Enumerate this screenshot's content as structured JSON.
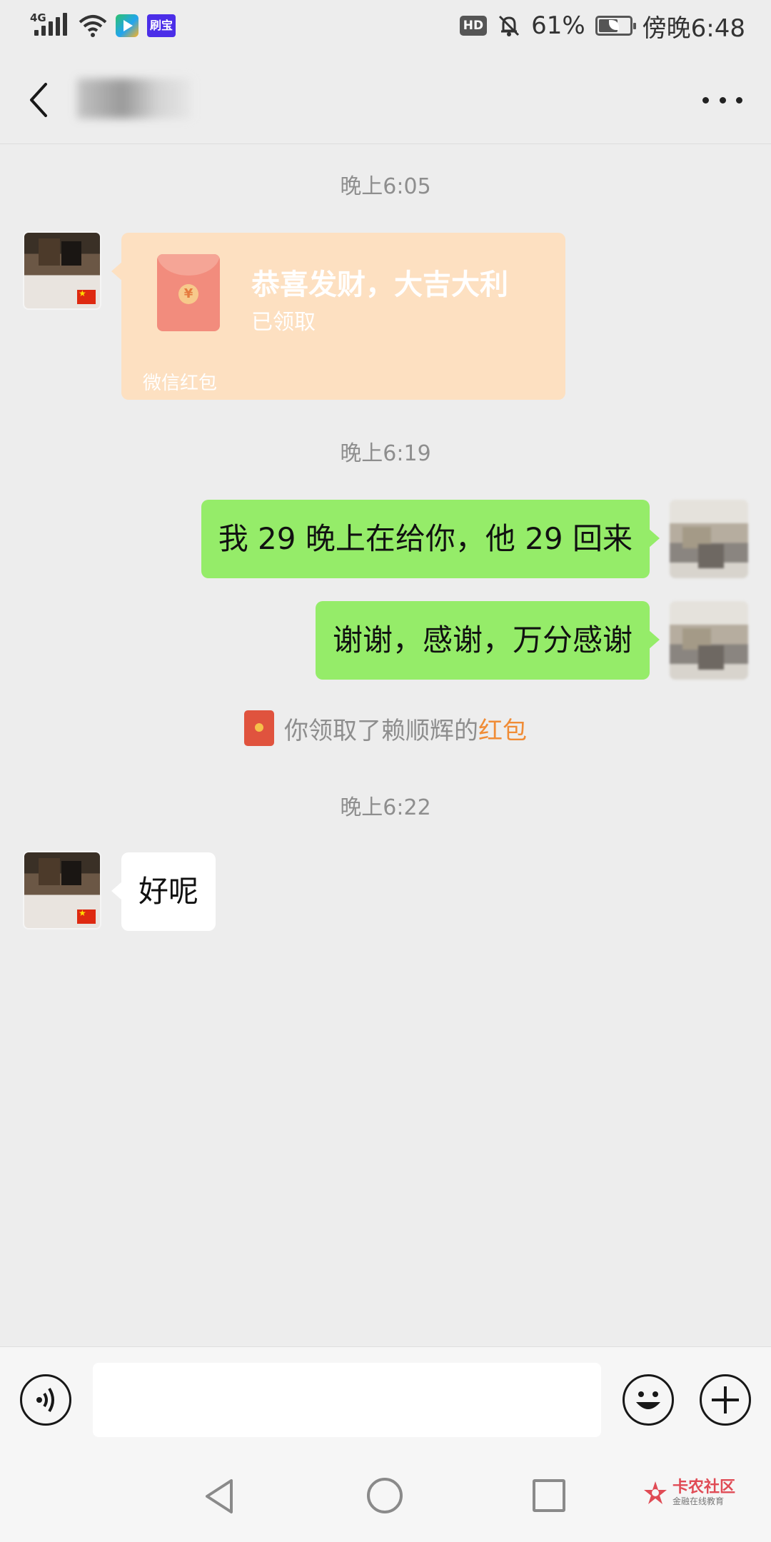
{
  "status_bar": {
    "network": "4G",
    "shuabao_badge": "刷宝",
    "hd_badge": "HD",
    "battery_percent": "61%",
    "battery_level": 0.61,
    "time": "傍晚6:48"
  },
  "header": {
    "icons": {
      "back": "chevron-left-icon",
      "more": "more-dots-icon"
    }
  },
  "messages": {
    "ts1": "晚上6:05",
    "red_packet": {
      "title": "恭喜发财，大吉大利",
      "status": "已领取",
      "footer": "微信红包",
      "coin_glyph": "¥"
    },
    "ts2": "晚上6:19",
    "msg1": "我 29 晚上在给你，他 29 回来",
    "msg2": "谢谢，感谢，万分感谢",
    "system": {
      "text": "你领取了赖顺辉的",
      "link": "红包"
    },
    "ts3": "晚上6:22",
    "msg3": "好呢"
  },
  "input_bar": {
    "icons": {
      "voice": "voice-icon",
      "emoji": "emoji-icon",
      "plus": "plus-icon"
    }
  },
  "nav_bar": {
    "watermark_title": "卡农社区",
    "watermark_sub": "金融在线教育"
  },
  "colors": {
    "bubble_self": "#95ec69",
    "bubble_peer": "#ffffff",
    "red_packet_bg": "#fde0c1",
    "link_orange": "#f08c36",
    "background": "#ededed"
  }
}
